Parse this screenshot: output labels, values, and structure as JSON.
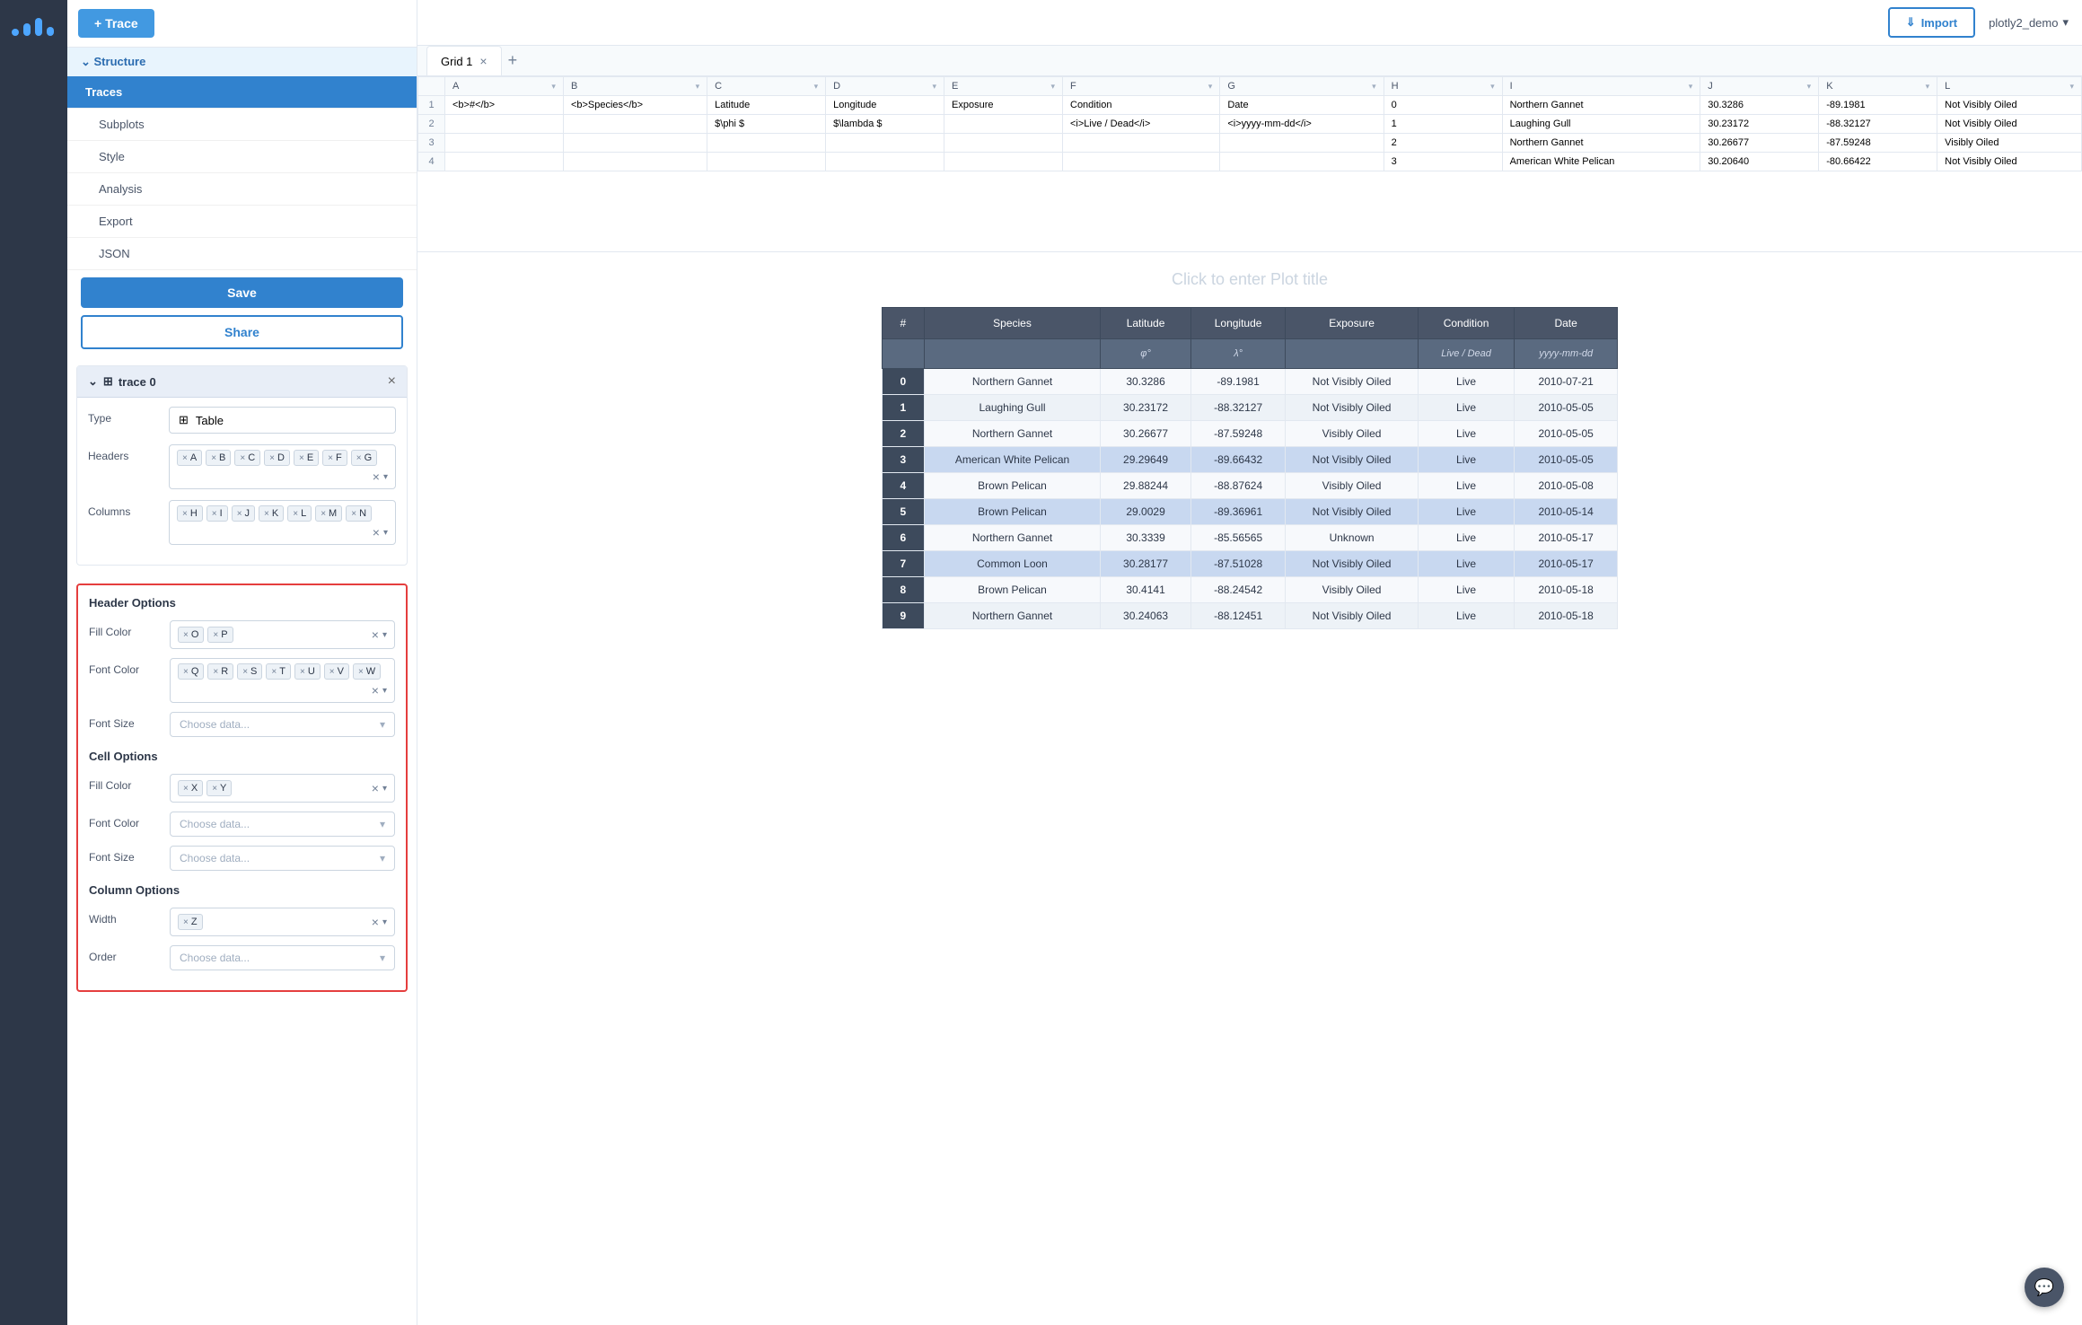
{
  "app": {
    "title": "plotly2_demo",
    "logo_alt": "Plotly logo"
  },
  "top_bar": {
    "import_label": "Import",
    "user_name": "plotly2_demo",
    "dropdown_icon": "▾"
  },
  "left_nav": {
    "structure_label": "Structure",
    "items": [
      {
        "id": "traces",
        "label": "Traces",
        "active": true
      },
      {
        "id": "subplots",
        "label": "Subplots",
        "active": false
      },
      {
        "id": "style",
        "label": "Style",
        "active": false
      },
      {
        "id": "analysis",
        "label": "Analysis",
        "active": false
      },
      {
        "id": "export",
        "label": "Export",
        "active": false
      },
      {
        "id": "json",
        "label": "JSON",
        "active": false
      }
    ],
    "save_label": "Save",
    "share_label": "Share"
  },
  "add_trace_btn": "+ Trace",
  "trace_panel": {
    "title": "trace 0",
    "close_icon": "×",
    "type_label": "Type",
    "type_value": "Table",
    "type_icon": "⊞",
    "headers_label": "Headers",
    "header_tags": [
      "A",
      "B",
      "C",
      "D",
      "E",
      "F",
      "G"
    ],
    "columns_label": "Columns",
    "column_tags": [
      "H",
      "I",
      "J",
      "K",
      "L",
      "M",
      "N"
    ]
  },
  "header_options": {
    "title": "Header Options",
    "fill_color_label": "Fill Color",
    "fill_color_tags": [
      "O",
      "P"
    ],
    "font_color_label": "Font Color",
    "font_color_tags": [
      "Q",
      "R",
      "S",
      "T",
      "U",
      "V",
      "W"
    ],
    "font_size_label": "Font Size",
    "font_size_placeholder": "Choose data..."
  },
  "cell_options": {
    "title": "Cell Options",
    "fill_color_label": "Fill Color",
    "fill_color_tags": [
      "X",
      "Y"
    ],
    "font_color_label": "Font Color",
    "font_color_placeholder": "Choose data...",
    "font_size_label": "Font Size",
    "font_size_placeholder": "Choose data..."
  },
  "column_options": {
    "title": "Column Options",
    "width_label": "Width",
    "width_tags": [
      "Z"
    ],
    "order_label": "Order",
    "order_placeholder": "Choose data..."
  },
  "grid": {
    "tab_name": "Grid 1",
    "add_tab_icon": "+",
    "columns": [
      {
        "id": "A",
        "label": "A"
      },
      {
        "id": "B",
        "label": "B"
      },
      {
        "id": "C",
        "label": "C"
      },
      {
        "id": "D",
        "label": "D"
      },
      {
        "id": "E",
        "label": "E"
      },
      {
        "id": "F",
        "label": "F"
      },
      {
        "id": "G",
        "label": "G"
      },
      {
        "id": "H",
        "label": "H"
      },
      {
        "id": "I",
        "label": "I"
      },
      {
        "id": "J",
        "label": "J"
      },
      {
        "id": "K",
        "label": "K"
      },
      {
        "id": "L",
        "label": "L"
      }
    ],
    "rows": [
      {
        "num": "1",
        "A": "<b>#</b>",
        "B": "<b>Species</b>",
        "C": "Latitude",
        "D": "Longitude",
        "E": "Exposure",
        "F": "Condition",
        "G": "Date",
        "H": "0",
        "I": "Northern Gannet",
        "J": "30.3286",
        "K": "-89.1981",
        "L": "Not Visibly Oiled"
      },
      {
        "num": "2",
        "A": "",
        "B": "",
        "C": "$\\phi $",
        "D": "$\\lambda $",
        "E": "",
        "F": "<i>Live / Dead</i>",
        "G": "<i>yyyy-mm-dd</i>",
        "H": "1",
        "I": "Laughing Gull",
        "J": "30.23172",
        "K": "-88.32127",
        "L": "Not Visibly Oiled"
      },
      {
        "num": "3",
        "A": "",
        "B": "",
        "C": "",
        "D": "",
        "E": "",
        "F": "",
        "G": "",
        "H": "2",
        "I": "Northern Gannet",
        "J": "30.26677",
        "K": "-87.59248",
        "L": "Visibly Oiled"
      },
      {
        "num": "4",
        "A": "",
        "B": "",
        "C": "",
        "D": "",
        "E": "",
        "F": "",
        "G": "",
        "H": "3",
        "I": "American White Pelican",
        "J": "30.20640",
        "K": "-80.66422",
        "L": "Not Visibly Oiled"
      }
    ]
  },
  "chart": {
    "plot_title_placeholder": "Click to enter Plot title",
    "table": {
      "headers": [
        "#",
        "Species",
        "Latitude",
        "Longitude",
        "Exposure",
        "Condition",
        "Date"
      ],
      "sub_headers": [
        "",
        "",
        "φ°",
        "λ°",
        "",
        "Live / Dead",
        "yyyy-mm-dd"
      ],
      "rows": [
        {
          "num": "0",
          "species": "Northern Gannet",
          "lat": "30.3286",
          "lon": "-89.1981",
          "exposure": "Not Visibly Oiled",
          "condition": "Live",
          "date": "2010-07-21",
          "highlight": false
        },
        {
          "num": "1",
          "species": "Laughing Gull",
          "lat": "30.23172",
          "lon": "-88.32127",
          "exposure": "Not Visibly Oiled",
          "condition": "Live",
          "date": "2010-05-05",
          "highlight": false
        },
        {
          "num": "2",
          "species": "Northern Gannet",
          "lat": "30.26677",
          "lon": "-87.59248",
          "exposure": "Visibly Oiled",
          "condition": "Live",
          "date": "2010-05-05",
          "highlight": false
        },
        {
          "num": "3",
          "species": "American White Pelican",
          "lat": "29.29649",
          "lon": "-89.66432",
          "exposure": "Not Visibly Oiled",
          "condition": "Live",
          "date": "2010-05-05",
          "highlight": true
        },
        {
          "num": "4",
          "species": "Brown Pelican",
          "lat": "29.88244",
          "lon": "-88.87624",
          "exposure": "Visibly Oiled",
          "condition": "Live",
          "date": "2010-05-08",
          "highlight": false
        },
        {
          "num": "5",
          "species": "Brown Pelican",
          "lat": "29.0029",
          "lon": "-89.36961",
          "exposure": "Not Visibly Oiled",
          "condition": "Live",
          "date": "2010-05-14",
          "highlight": true
        },
        {
          "num": "6",
          "species": "Northern Gannet",
          "lat": "30.3339",
          "lon": "-85.56565",
          "exposure": "Unknown",
          "condition": "Live",
          "date": "2010-05-17",
          "highlight": false
        },
        {
          "num": "7",
          "species": "Common Loon",
          "lat": "30.28177",
          "lon": "-87.51028",
          "exposure": "Not Visibly Oiled",
          "condition": "Live",
          "date": "2010-05-17",
          "highlight": true
        },
        {
          "num": "8",
          "species": "Brown Pelican",
          "lat": "30.4141",
          "lon": "-88.24542",
          "exposure": "Visibly Oiled",
          "condition": "Live",
          "date": "2010-05-18",
          "highlight": false
        },
        {
          "num": "9",
          "species": "Northern Gannet",
          "lat": "30.24063",
          "lon": "-88.12451",
          "exposure": "Not Visibly Oiled",
          "condition": "Live",
          "date": "2010-05-18",
          "highlight": false
        }
      ]
    }
  }
}
